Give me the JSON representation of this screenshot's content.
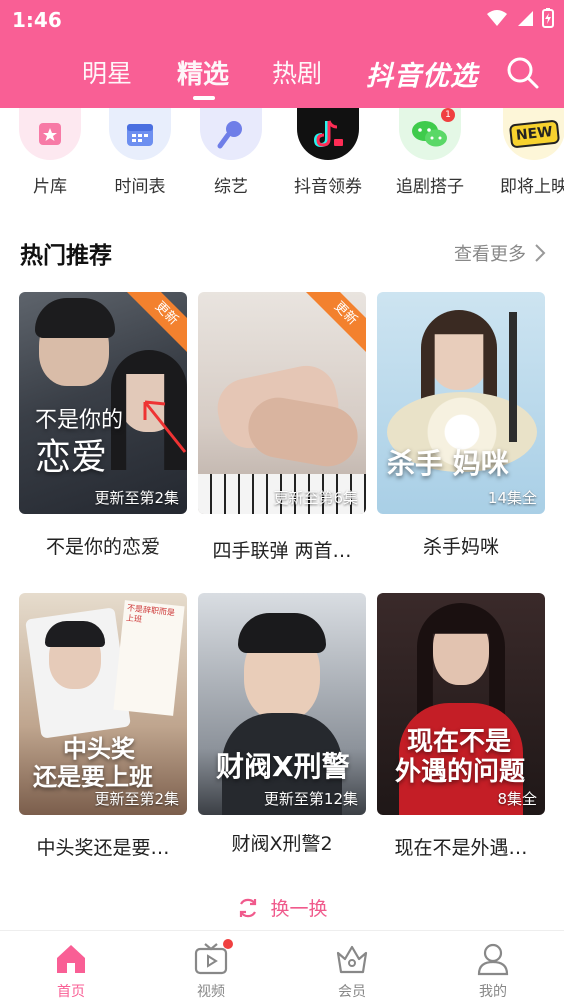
{
  "status": {
    "time": "1:46"
  },
  "top_nav": {
    "tabs": [
      {
        "label": "明星"
      },
      {
        "label": "精选"
      },
      {
        "label": "热剧"
      }
    ],
    "active_tab": "精选",
    "brand": "抖音优选"
  },
  "shortcuts": [
    {
      "label": "片库",
      "icon": "film-library-icon"
    },
    {
      "label": "时间表",
      "icon": "calendar-icon"
    },
    {
      "label": "综艺",
      "icon": "microphone-icon"
    },
    {
      "label": "抖音领券",
      "icon": "douyin-coupon-icon"
    },
    {
      "label": "追剧搭子",
      "icon": "wechat-chat-icon",
      "badge": "1"
    },
    {
      "label": "即将上映",
      "icon": "new-badge-icon",
      "badge_text": "NEW"
    }
  ],
  "section": {
    "title": "热门推荐",
    "more_label": "查看更多"
  },
  "cards": [
    {
      "title": "不是你的恋爱",
      "caption": "更新至第2集",
      "ribbon": "更新",
      "art_text": [
        "不是你的",
        "恋爱"
      ]
    },
    {
      "title": "四手联弹 两首…",
      "caption": "更新至第6集",
      "ribbon": "更新"
    },
    {
      "title": "杀手妈咪",
      "caption": "14集全",
      "art_text": [
        "杀手 妈咪"
      ]
    },
    {
      "title": "中头奖还是要…",
      "caption": "更新至第2集",
      "art_text": [
        "中头奖",
        "还是要上班"
      ],
      "tag": "不是辞职而是上班"
    },
    {
      "title": "财阀X刑警2",
      "caption": "更新至第12集",
      "art_text": [
        "财阀X刑警"
      ]
    },
    {
      "title": "现在不是外遇…",
      "caption": "8集全",
      "art_text": [
        "现在不是",
        "外遇的问题"
      ]
    }
  ],
  "refresh_label": "换一换",
  "bottom_nav": [
    {
      "label": "首页",
      "icon": "home-icon"
    },
    {
      "label": "视频",
      "icon": "tv-icon"
    },
    {
      "label": "会员",
      "icon": "crown-icon"
    },
    {
      "label": "我的",
      "icon": "person-icon"
    }
  ],
  "colors": {
    "brand_pink": "#f95f95",
    "ribbon_orange": "#f3812e",
    "refresh_pink": "#f05a8c"
  }
}
